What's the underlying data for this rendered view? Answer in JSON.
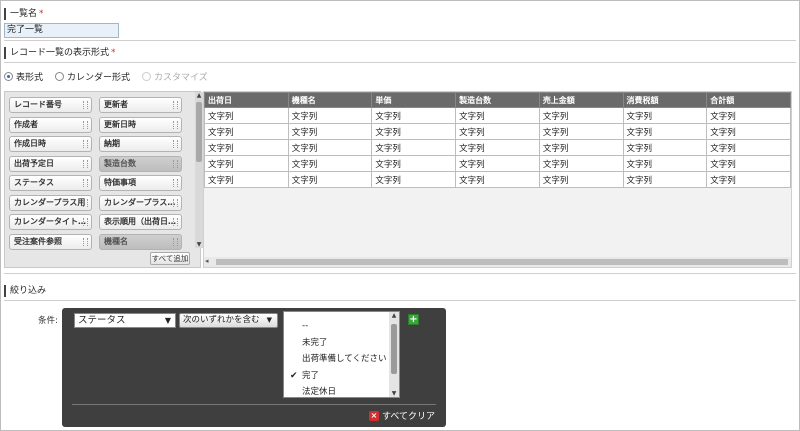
{
  "name_section": {
    "label": "一覧名",
    "required_mark": "*",
    "value": "完了一覧"
  },
  "format_section": {
    "label": "レコード一覧の表示形式",
    "required_mark": "*",
    "options": [
      {
        "label": "表形式",
        "selected": true,
        "disabled": false
      },
      {
        "label": "カレンダー形式",
        "selected": false,
        "disabled": false
      },
      {
        "label": "カスタマイズ",
        "selected": false,
        "disabled": true
      }
    ]
  },
  "palette": {
    "fields": [
      {
        "label": "レコード番号",
        "used": false
      },
      {
        "label": "更新者",
        "used": false
      },
      {
        "label": "作成者",
        "used": false
      },
      {
        "label": "更新日時",
        "used": false
      },
      {
        "label": "作成日時",
        "used": false
      },
      {
        "label": "納期",
        "used": false
      },
      {
        "label": "出荷予定日",
        "used": false
      },
      {
        "label": "製造台数",
        "used": true
      },
      {
        "label": "ステータス",
        "used": false
      },
      {
        "label": "特価事項",
        "used": false
      },
      {
        "label": "カレンダープラス用",
        "used": false
      },
      {
        "label": "カレンダープラス…",
        "used": false
      },
      {
        "label": "カレンダータイト…",
        "used": false
      },
      {
        "label": "表示順用（出荷日…",
        "used": false
      },
      {
        "label": "受注案件参照",
        "used": false
      },
      {
        "label": "機種名",
        "used": true
      }
    ],
    "add_all_label": "すべて追加"
  },
  "preview_table": {
    "columns": [
      "出荷日",
      "機種名",
      "単価",
      "製造台数",
      "売上金額",
      "消費税額",
      "合計額"
    ],
    "cell_text": "文字列",
    "row_count": 5
  },
  "filter_section": {
    "label": "絞り込み",
    "condition_label": "条件:",
    "field_select": "ステータス",
    "operator_select": "次のいずれかを含む",
    "options": [
      {
        "label": "--",
        "checked": false
      },
      {
        "label": "未完了",
        "checked": false
      },
      {
        "label": "出荷準備してください",
        "checked": false
      },
      {
        "label": "完了",
        "checked": true
      },
      {
        "label": "法定休日",
        "checked": false
      }
    ],
    "add_icon": "plus-icon",
    "clear_all_label": "すべてクリア",
    "colors": {
      "panel": "#3f3f3f",
      "add": "#3da53d",
      "clear": "#d32f2f"
    }
  }
}
